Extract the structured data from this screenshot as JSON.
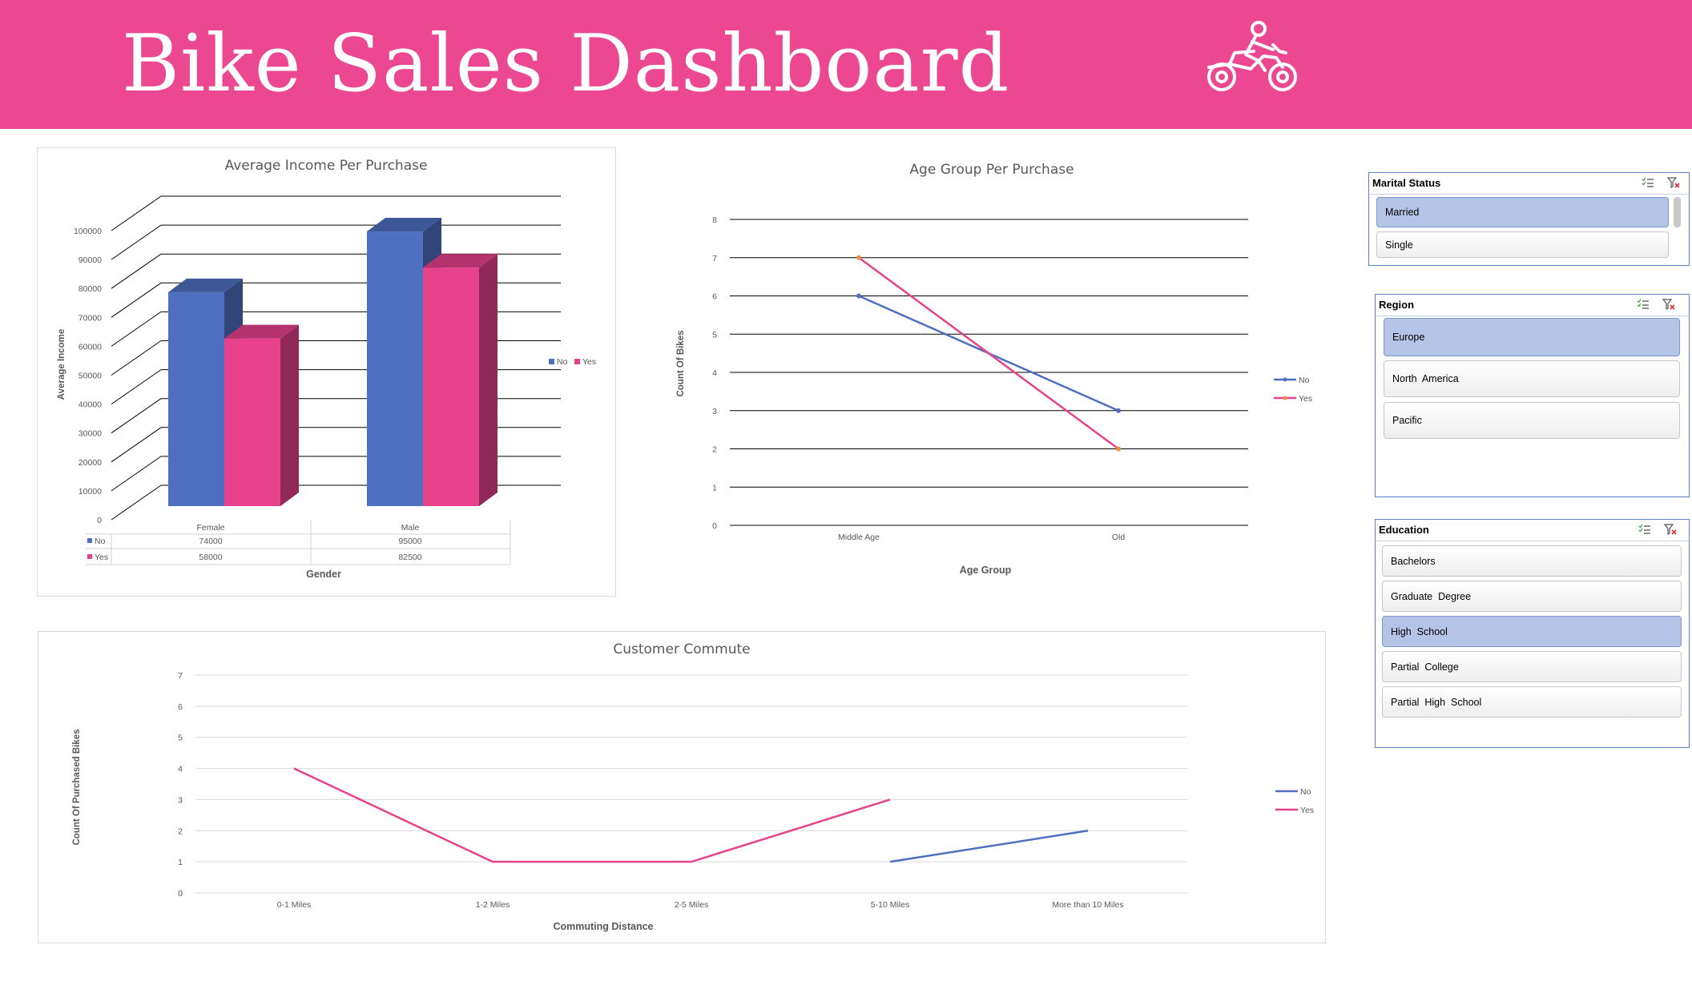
{
  "header": {
    "title": "Bike Sales Dashboard",
    "icon": "motorbike-rider-icon",
    "background": "#ec4791"
  },
  "colors": {
    "no": "#4f6fc1",
    "yes": "#e8428c"
  },
  "charts": {
    "income": {
      "title": "Average Income Per Purchase",
      "ylabel": "Average Income",
      "xlabel": "Gender",
      "legend_no": "No",
      "legend_yes": "Yes",
      "row_no": "No",
      "row_yes": "Yes",
      "female_no": "74000",
      "male_no": "95000",
      "female_yes": "58000",
      "male_yes": "82500"
    },
    "age": {
      "title": "Age Group Per Purchase",
      "ylabel": "Count Of Bikes",
      "xlabel": "Age Group",
      "legend_no": "No",
      "legend_yes": "Yes"
    },
    "commute": {
      "title": "Customer Commute",
      "ylabel": "Count Of Purchased Bikes",
      "xlabel": "Commuting Distance",
      "legend_no": "No",
      "legend_yes": "Yes"
    }
  },
  "chart_data": [
    {
      "type": "bar",
      "title": "Average Income Per Purchase",
      "xlabel": "Gender",
      "ylabel": "Average Income",
      "categories": [
        "Female",
        "Male"
      ],
      "series": [
        {
          "name": "No",
          "values": [
            74000,
            95000
          ]
        },
        {
          "name": "Yes",
          "values": [
            58000,
            82500
          ]
        }
      ],
      "ylim": [
        0,
        100000
      ],
      "yticks": [
        "0",
        "10000",
        "20000",
        "30000",
        "40000",
        "50000",
        "60000",
        "70000",
        "80000",
        "90000",
        "100000"
      ],
      "legend": "right",
      "grid": true
    },
    {
      "type": "line",
      "title": "Age Group Per Purchase",
      "xlabel": "Age Group",
      "ylabel": "Count Of Bikes",
      "categories": [
        "Middle Age",
        "Old"
      ],
      "series": [
        {
          "name": "No",
          "values": [
            6,
            3
          ]
        },
        {
          "name": "Yes",
          "values": [
            7,
            2
          ]
        }
      ],
      "ylim": [
        0,
        8
      ],
      "legend": "right",
      "grid": true
    },
    {
      "type": "line",
      "title": "Customer Commute",
      "xlabel": "Commuting Distance",
      "ylabel": "Count Of Purchased Bikes",
      "categories": [
        "0-1 Miles",
        "1-2 Miles",
        "2-5 Miles",
        "5-10 Miles",
        "More than 10 Miles"
      ],
      "series": [
        {
          "name": "No",
          "values": [
            null,
            null,
            null,
            1,
            2
          ]
        },
        {
          "name": "Yes",
          "values": [
            4,
            1,
            1,
            3,
            null
          ]
        }
      ],
      "ylim": [
        0,
        7
      ],
      "legend": "right",
      "grid": true
    }
  ],
  "slicers": {
    "marital": {
      "title": "Marital Status",
      "items": [
        "Married",
        "Single"
      ],
      "selected": [
        "Married"
      ]
    },
    "region": {
      "title": "Region",
      "items": [
        "Europe",
        "North  America",
        "Pacific"
      ],
      "selected": [
        "Europe"
      ]
    },
    "education": {
      "title": "Education",
      "items": [
        "Bachelors",
        "Graduate  Degree",
        "High  School",
        "Partial  College",
        "Partial  High  School"
      ],
      "selected": [
        "High  School"
      ]
    }
  }
}
